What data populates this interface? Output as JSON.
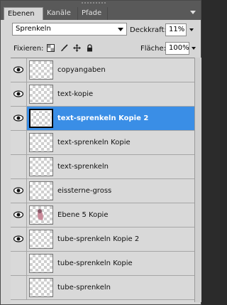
{
  "tabs": [
    {
      "label": "Ebenen",
      "active": true
    },
    {
      "label": "Kanäle",
      "active": false
    },
    {
      "label": "Pfade",
      "active": false
    }
  ],
  "blend_mode": "Sprenkeln",
  "opacity_label": "Deckkraft:",
  "opacity_value": "11%",
  "lock_label": "Fixieren:",
  "fill_label": "Fläche:",
  "fill_value": "100%",
  "colors": {
    "selected_row": "#3a8ee6",
    "panel_bg": "#d6d6d6",
    "tabbar_bg": "#595959"
  },
  "layers": [
    {
      "name": "copyangaben",
      "visible": true,
      "selected": false
    },
    {
      "name": "text-kopie",
      "visible": true,
      "selected": false
    },
    {
      "name": "text-sprenkeln Kopie 2",
      "visible": true,
      "selected": true
    },
    {
      "name": "text-sprenkeln Kopie",
      "visible": false,
      "selected": false
    },
    {
      "name": "text-sprenkeln",
      "visible": false,
      "selected": false
    },
    {
      "name": "eissterne-gross",
      "visible": true,
      "selected": false
    },
    {
      "name": "Ebene 5 Kopie",
      "visible": true,
      "selected": false
    },
    {
      "name": "tube-sprenkeln Kopie 2",
      "visible": true,
      "selected": false
    },
    {
      "name": "tube-sprenkeln Kopie",
      "visible": false,
      "selected": false
    },
    {
      "name": "tube-sprenkeln",
      "visible": false,
      "selected": false
    }
  ]
}
